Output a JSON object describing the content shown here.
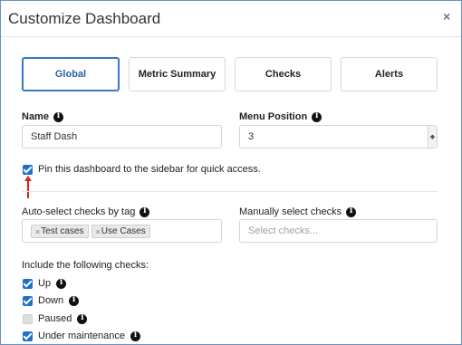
{
  "modal": {
    "title": "Customize Dashboard",
    "close_glyph": "×",
    "close_icon": "close-icon"
  },
  "tabs": [
    {
      "label": "Global",
      "active": true
    },
    {
      "label": "Metric Summary",
      "active": false
    },
    {
      "label": "Checks",
      "active": false
    },
    {
      "label": "Alerts",
      "active": false
    }
  ],
  "name_field": {
    "label": "Name",
    "value": "Staff Dash"
  },
  "menu_position": {
    "label": "Menu Position",
    "value": "3"
  },
  "pin": {
    "label": "Pin this dashboard to the sidebar for quick access.",
    "checked": true
  },
  "auto_select": {
    "label": "Auto-select checks by tag",
    "tags": [
      "Test cases",
      "Use Cases"
    ]
  },
  "manual_select": {
    "label": "Manually select checks",
    "placeholder": "Select checks..."
  },
  "include": {
    "label": "Include the following checks:",
    "options": [
      {
        "label": "Up",
        "checked": true
      },
      {
        "label": "Down",
        "checked": true
      },
      {
        "label": "Paused",
        "checked": false
      },
      {
        "label": "Under maintenance",
        "checked": true
      }
    ]
  },
  "colors": {
    "accent": "#1f6fd0",
    "active_tab_border": "#3a78c7",
    "annotation_arrow": "#d9261c"
  }
}
